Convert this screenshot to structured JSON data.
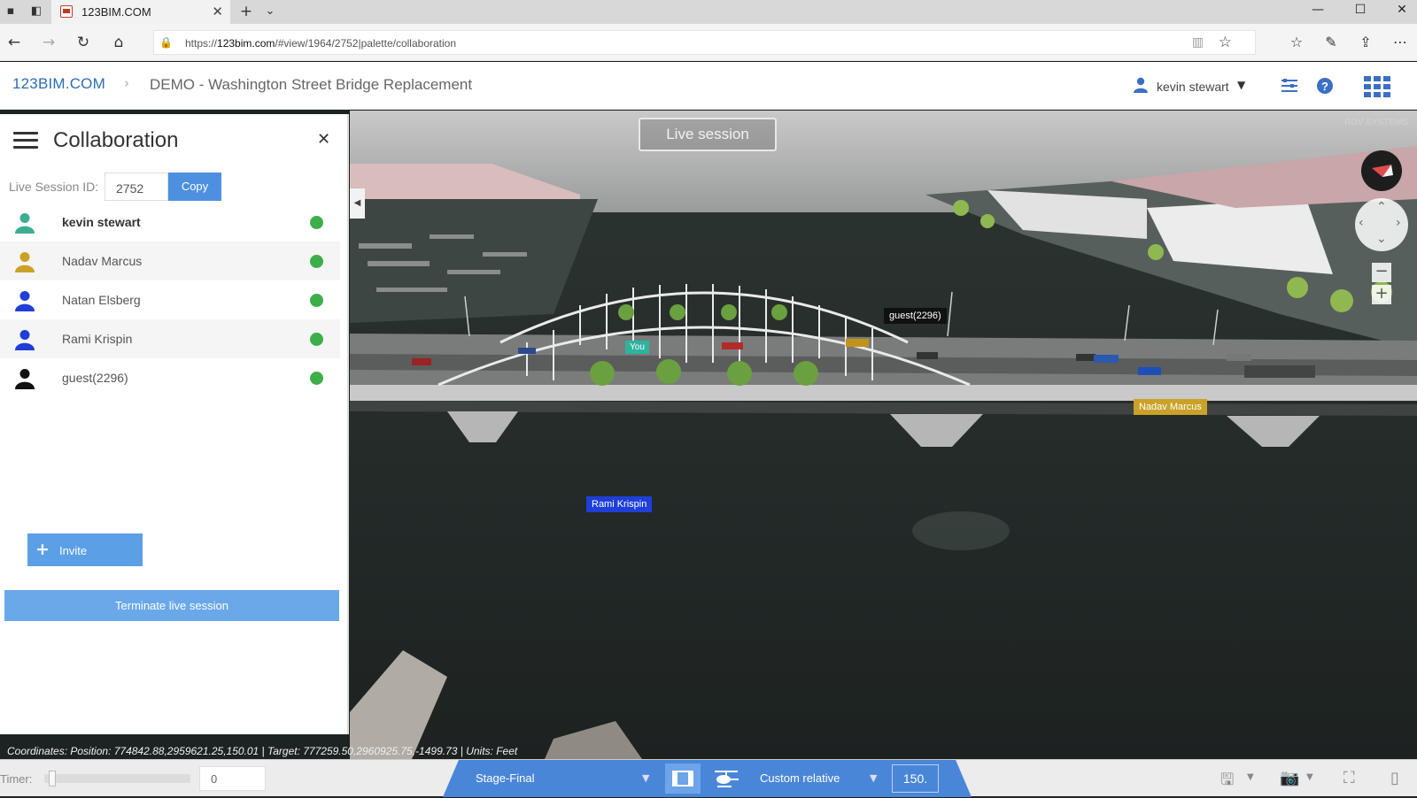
{
  "browser": {
    "tab_title": "123BIM.COM",
    "url_prefix": "https://",
    "url_host": "123bim.com",
    "url_path": "/#view/1964/2752|palette/collaboration"
  },
  "header": {
    "logo": "123BIM.COM",
    "project_title": "DEMO - Washington Street Bridge Replacement",
    "user_name": "kevin stewart"
  },
  "viewport": {
    "live_session_label": "Live session",
    "brand_mark": "RDV SYSTEMS",
    "user_tags": {
      "you": "You",
      "guest": "guest(2296)",
      "nadav": "Nadav Marcus",
      "rami": "Rami Krispin"
    },
    "coordinates_text": "Coordinates: Position: 774842.88,2959621.25,150.01 | Target: 777259.50,2960925.75,-1499.73 | Units: Feet"
  },
  "panel": {
    "title": "Collaboration",
    "session_id_label": "Live Session ID:",
    "session_id_value": "2752",
    "copy_label": "Copy",
    "members": [
      {
        "name": "kevin stewart",
        "color": "#3aae8f",
        "status": "online"
      },
      {
        "name": "Nadav Marcus",
        "color": "#c9a227",
        "status": "online"
      },
      {
        "name": "Natan Elsberg",
        "color": "#1f3fd8",
        "status": "online"
      },
      {
        "name": "Rami Krispin",
        "color": "#1f3fd8",
        "status": "online"
      },
      {
        "name": "guest(2296)",
        "color": "#111111",
        "status": "online"
      }
    ],
    "invite_label": "Invite",
    "terminate_label": "Terminate live session"
  },
  "bottombar": {
    "timer_label": "Timer:",
    "timer_value": "0",
    "stage_value": "Stage-Final",
    "mode_value": "Custom relative",
    "height_value": "150."
  },
  "colors": {
    "accent": "#4a86d8",
    "online": "#3dae49"
  }
}
